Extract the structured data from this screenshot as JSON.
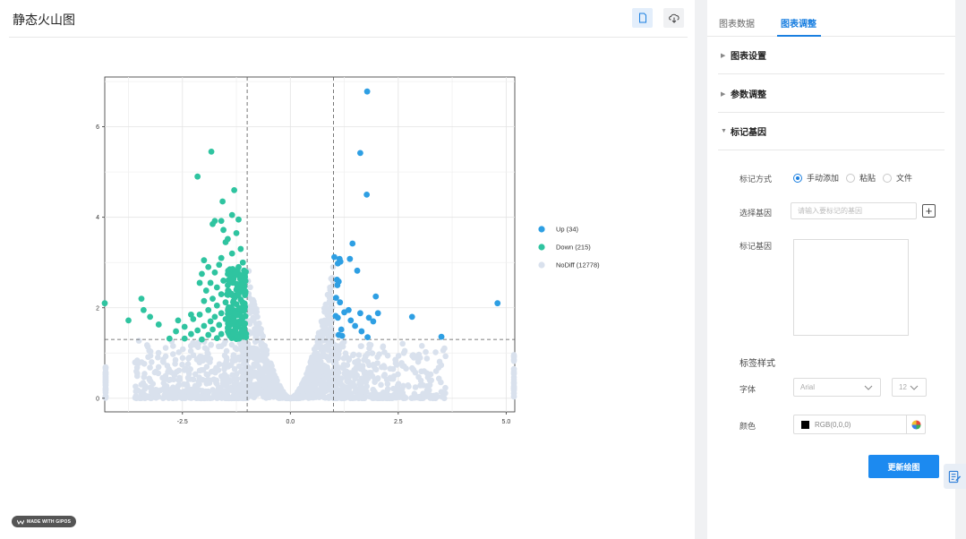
{
  "header": {
    "title": "静态火山图",
    "copy_icon": "document-icon",
    "download_icon": "cloud-download-icon"
  },
  "watermark": "MADE WITH GIPOS",
  "chart_data": {
    "type": "scatter",
    "title": "",
    "xlabel": "",
    "ylabel": "",
    "xlim": [
      -4.3,
      5.2
    ],
    "ylim": [
      -0.3,
      7.1
    ],
    "x_ticks": [
      -2.5,
      0.0,
      2.5,
      5.0
    ],
    "x_tick_labels": [
      "-2.5",
      "0.0",
      "2.5",
      "5.0"
    ],
    "y_ticks": [
      0,
      2,
      4,
      6
    ],
    "y_tick_labels": [
      "0",
      "2",
      "4",
      "6"
    ],
    "thresholds": {
      "x": [
        -1,
        1
      ],
      "y": 1.3,
      "style": "dashed"
    },
    "grid": true,
    "legend_position": "right",
    "series": [
      {
        "name": "Up (34)",
        "color": "#2e9fe3",
        "points": [
          [
            1.78,
            6.78
          ],
          [
            1.62,
            5.42
          ],
          [
            1.77,
            4.5
          ],
          [
            1.44,
            3.42
          ],
          [
            1.02,
            3.12
          ],
          [
            1.14,
            3.08
          ],
          [
            1.38,
            3.08
          ],
          [
            1.1,
            2.98
          ],
          [
            1.16,
            3.02
          ],
          [
            1.55,
            2.82
          ],
          [
            1.12,
            2.58
          ],
          [
            1.08,
            2.62
          ],
          [
            1.09,
            2.5
          ],
          [
            1.06,
            2.22
          ],
          [
            1.98,
            2.25
          ],
          [
            1.15,
            2.12
          ],
          [
            1.62,
            1.88
          ],
          [
            2.03,
            1.88
          ],
          [
            1.05,
            1.82
          ],
          [
            1.1,
            1.78
          ],
          [
            1.82,
            1.78
          ],
          [
            2.82,
            1.8
          ],
          [
            1.4,
            1.72
          ],
          [
            1.92,
            1.7
          ],
          [
            1.18,
            1.52
          ],
          [
            1.65,
            1.48
          ],
          [
            1.12,
            1.4
          ],
          [
            1.2,
            1.38
          ],
          [
            1.79,
            1.35
          ],
          [
            3.5,
            1.36
          ],
          [
            4.8,
            2.1
          ],
          [
            1.35,
            1.95
          ],
          [
            1.5,
            1.6
          ],
          [
            1.25,
            1.9
          ]
        ]
      },
      {
        "name": "Down (215)",
        "color": "#2fc4a0",
        "points": [
          [
            -1.83,
            5.45
          ],
          [
            -2.15,
            4.9
          ],
          [
            -1.3,
            4.6
          ],
          [
            -1.57,
            4.35
          ],
          [
            -1.35,
            4.05
          ],
          [
            -1.2,
            3.95
          ],
          [
            -1.75,
            3.92
          ],
          [
            -1.6,
            3.92
          ],
          [
            -1.8,
            3.85
          ],
          [
            -1.55,
            3.72
          ],
          [
            -1.25,
            3.65
          ],
          [
            -1.45,
            3.52
          ],
          [
            -1.5,
            3.45
          ],
          [
            -1.15,
            3.3
          ],
          [
            -1.35,
            3.2
          ],
          [
            -1.6,
            3.1
          ],
          [
            -2.0,
            3.05
          ],
          [
            -1.1,
            3.0
          ],
          [
            -1.65,
            2.95
          ],
          [
            -1.9,
            2.9
          ],
          [
            -1.2,
            2.9
          ],
          [
            -1.4,
            2.85
          ],
          [
            -1.75,
            2.78
          ],
          [
            -2.05,
            2.75
          ],
          [
            -1.3,
            2.72
          ],
          [
            -1.05,
            2.68
          ],
          [
            -1.55,
            2.6
          ],
          [
            -1.85,
            2.55
          ],
          [
            -2.1,
            2.55
          ],
          [
            -1.15,
            2.52
          ],
          [
            -1.45,
            2.5
          ],
          [
            -1.7,
            2.45
          ],
          [
            -1.25,
            2.4
          ],
          [
            -1.95,
            2.38
          ],
          [
            -1.05,
            2.35
          ],
          [
            -1.6,
            2.3
          ],
          [
            -1.35,
            2.28
          ],
          [
            -1.8,
            2.2
          ],
          [
            -1.15,
            2.18
          ],
          [
            -2.0,
            2.15
          ],
          [
            -1.5,
            2.12
          ],
          [
            -1.25,
            2.08
          ],
          [
            -1.7,
            2.05
          ],
          [
            -1.05,
            2.02
          ],
          [
            -1.4,
            1.98
          ],
          [
            -1.9,
            1.95
          ],
          [
            -1.2,
            1.92
          ],
          [
            -1.6,
            1.88
          ],
          [
            -2.1,
            1.85
          ],
          [
            -1.3,
            1.82
          ],
          [
            -1.75,
            1.8
          ],
          [
            -1.1,
            1.78
          ],
          [
            -1.5,
            1.75
          ],
          [
            -2.25,
            1.75
          ],
          [
            -1.85,
            1.7
          ],
          [
            -1.35,
            1.68
          ],
          [
            -1.05,
            1.65
          ],
          [
            -1.65,
            1.62
          ],
          [
            -2.0,
            1.6
          ],
          [
            -1.2,
            1.58
          ],
          [
            -1.45,
            1.55
          ],
          [
            -1.8,
            1.52
          ],
          [
            -2.15,
            1.5
          ],
          [
            -1.3,
            1.48
          ],
          [
            -1.1,
            1.45
          ],
          [
            -1.6,
            1.42
          ],
          [
            -1.9,
            1.4
          ],
          [
            -1.4,
            1.38
          ],
          [
            -2.3,
            1.42
          ],
          [
            -1.15,
            1.35
          ],
          [
            -1.7,
            1.33
          ],
          [
            -2.45,
            1.32
          ],
          [
            -2.8,
            1.32
          ],
          [
            -1.25,
            1.31
          ],
          [
            -2.05,
            1.3
          ],
          [
            -4.3,
            2.1
          ],
          [
            -3.45,
            2.2
          ],
          [
            -3.4,
            1.95
          ],
          [
            -3.75,
            1.72
          ],
          [
            -3.25,
            1.8
          ],
          [
            -3.05,
            1.63
          ],
          [
            -2.3,
            1.85
          ],
          [
            -2.6,
            1.72
          ],
          [
            -2.65,
            1.48
          ],
          [
            -2.45,
            1.58
          ]
        ]
      },
      {
        "name": "NoDiff (12778)",
        "color": "#d9e1ed",
        "points": []
      }
    ]
  },
  "panel": {
    "tabs": [
      {
        "label": "图表数据",
        "active": false
      },
      {
        "label": "图表调整",
        "active": true
      }
    ],
    "sections": [
      {
        "label": "图表设置",
        "expanded": false
      },
      {
        "label": "参数调整",
        "expanded": false
      },
      {
        "label": "标记基因",
        "expanded": true
      }
    ],
    "mark_method": {
      "label": "标记方式",
      "options": [
        "手动添加",
        "粘贴",
        "文件"
      ],
      "selected": "手动添加"
    },
    "select_gene": {
      "label": "选择基因",
      "placeholder": "请输入要标记的基因",
      "add_icon": "plus-icon"
    },
    "marked_genes": {
      "label": "标记基因",
      "value": ""
    },
    "label_style": {
      "title": "标签样式",
      "font_label": "字体",
      "font_value": "Arial",
      "size_value": "12",
      "color_label": "颜色",
      "color_value": "RGB(0,0,0)",
      "color_hex": "#000000"
    },
    "update_button": "更新绘图"
  },
  "feedback_icon": "edit-note-icon"
}
